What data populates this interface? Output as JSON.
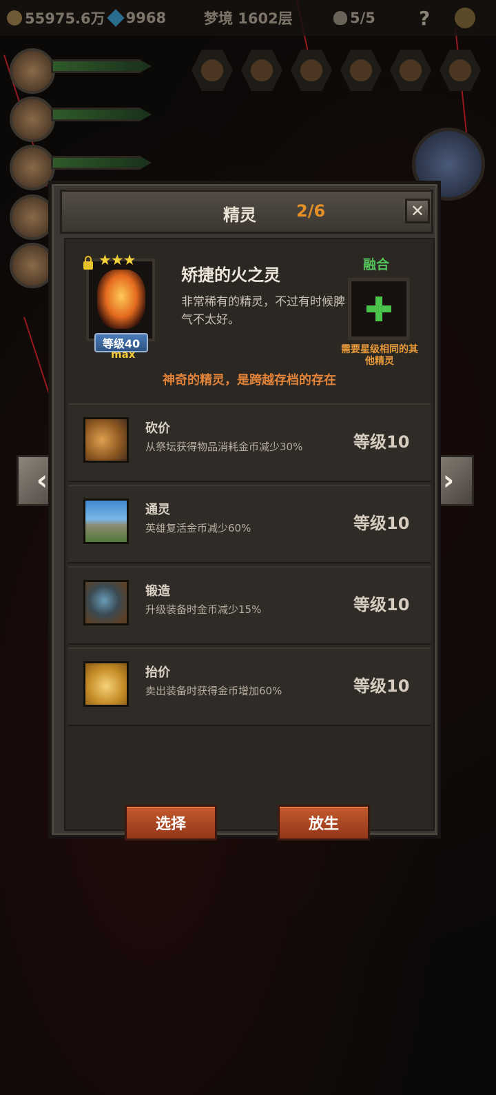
{
  "topbar": {
    "gold": "55975.6万",
    "gems": "9968",
    "dungeon": "梦境 1602层",
    "lives": "5/5",
    "help_symbol": "?"
  },
  "dialog": {
    "title": "精灵",
    "count": "2/6",
    "close_symbol": "✕"
  },
  "spirit": {
    "stars": "★★★",
    "level": "等级40",
    "max_label": "max",
    "name": "矫捷的火之灵",
    "description": "非常稀有的精灵，不过有时候脾气不太好。",
    "fuse_label": "融合",
    "fuse_hint": "需要星级相同的其他精灵",
    "tagline": "神奇的精灵，是跨越存档的存在"
  },
  "perks": [
    {
      "name": "砍价",
      "desc": "从祭坛获得物品消耗金币减少30%",
      "level": "等级10",
      "icon": "coins-icon"
    },
    {
      "name": "通灵",
      "desc": "英雄复活金币减少60%",
      "level": "等级10",
      "icon": "altar-icon"
    },
    {
      "name": "锻造",
      "desc": "升级装备时金币减少15%",
      "level": "等级10",
      "icon": "hammer-icon"
    },
    {
      "name": "抬价",
      "desc": "卖出装备时获得金币增加60%",
      "level": "等级10",
      "icon": "hand-coin-icon"
    }
  ],
  "buttons": {
    "select": "选择",
    "release": "放生"
  },
  "nav": {
    "prev": "‹",
    "next": "›"
  }
}
